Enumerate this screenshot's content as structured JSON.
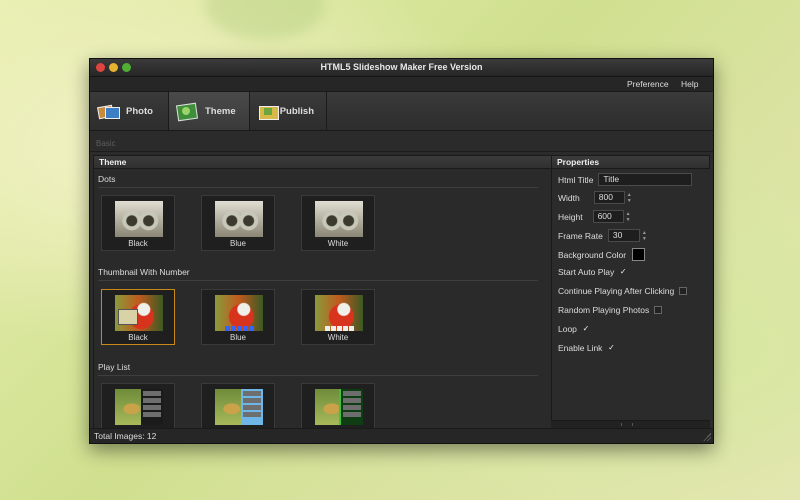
{
  "window": {
    "title": "HTML5 Slideshow Maker Free Version"
  },
  "menu": {
    "preference": "Preference",
    "help": "Help"
  },
  "tabs": [
    {
      "label": "Photo",
      "icon": "photo-icon"
    },
    {
      "label": "Theme",
      "icon": "theme-icon"
    },
    {
      "label": "Publish",
      "icon": "publish-icon"
    }
  ],
  "subheader": {
    "label": "Basic"
  },
  "theme_panel": {
    "title": "Theme",
    "groups": [
      {
        "title": "Dots",
        "items": [
          "Black",
          "Blue",
          "White"
        ]
      },
      {
        "title": "Thumbnail With Number",
        "items": [
          "Black",
          "Blue",
          "White"
        ]
      },
      {
        "title": "Play List",
        "items": [
          "",
          "",
          ""
        ]
      }
    ],
    "selected": "Thumbnail With Number / Black"
  },
  "properties_panel": {
    "title": "Properties",
    "html_title": {
      "label": "Html Title",
      "value": "Title"
    },
    "width": {
      "label": "Width",
      "value": "800"
    },
    "height": {
      "label": "Height",
      "value": "600"
    },
    "frame_rate": {
      "label": "Frame Rate",
      "value": "30"
    },
    "background_color": {
      "label": "Background Color",
      "value": "#000000"
    },
    "start_auto_play": {
      "label": "Start Auto Play",
      "checked": true,
      "mark": "✓"
    },
    "continue_playing": {
      "label": "Continue Playing After Clicking",
      "checked": false
    },
    "random_playing": {
      "label": "Random Playing Photos",
      "checked": false
    },
    "loop": {
      "label": "Loop",
      "checked": true,
      "mark": "✓"
    },
    "enable_link": {
      "label": "Enable Link",
      "checked": true,
      "mark": "✓"
    }
  },
  "status": {
    "total_images": "Total Images: 12"
  },
  "colors": {
    "selected_border": "#c78a1a",
    "window_bg": "#2b2b2b"
  }
}
